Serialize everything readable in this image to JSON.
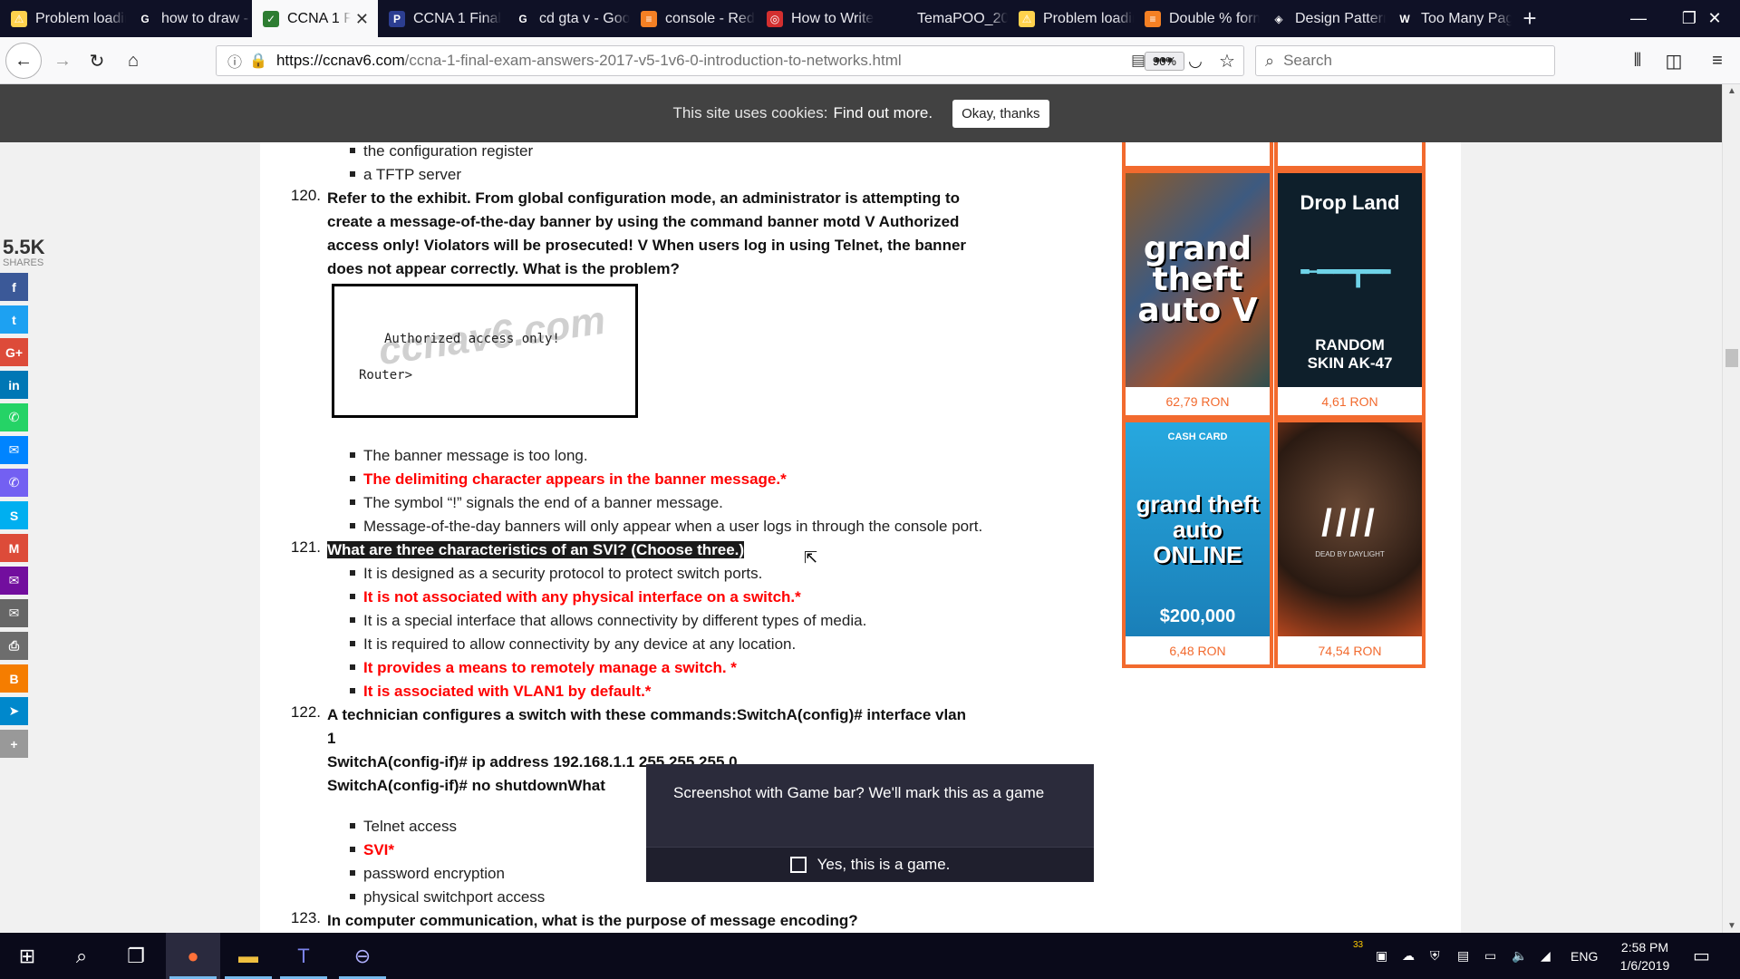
{
  "browser": {
    "tabs": [
      {
        "label": "Problem loading page",
        "icon_color": "#ffd24d",
        "glyph": "⚠"
      },
      {
        "label": "how to draw - Google",
        "icon_color": "#ffffff",
        "glyph": "G"
      },
      {
        "label": "CCNA 1 Final",
        "icon_color": "#2e7d32",
        "glyph": "✓",
        "active": true
      },
      {
        "label": "CCNA 1 Final",
        "icon_color": "#2c3e91",
        "glyph": "P"
      },
      {
        "label": "cd gta v - Google",
        "icon_color": "#ffffff",
        "glyph": "G"
      },
      {
        "label": "console - Red",
        "icon_color": "#f48024",
        "glyph": "≡"
      },
      {
        "label": "How to Write",
        "icon_color": "#d32f2f",
        "glyph": "◎"
      },
      {
        "label": "TemaPOO_2018.pdf",
        "icon_color": "",
        "glyph": ""
      },
      {
        "label": "Problem loading",
        "icon_color": "#ffd24d",
        "glyph": "⚠"
      },
      {
        "label": "Double % format",
        "icon_color": "#f48024",
        "glyph": "≡"
      },
      {
        "label": "Design Patterns",
        "icon_color": "#ffffff",
        "glyph": "◈"
      },
      {
        "label": "Too Many Pages",
        "icon_color": "#ffffff",
        "glyph": "W"
      }
    ],
    "url_host": "https://ccnav6.com",
    "url_path": "/ccna-1-final-exam-answers-2017-v5-1v6-0-introduction-to-networks.html",
    "zoom": "90%",
    "search_placeholder": "Search"
  },
  "cookie": {
    "text": "This site uses cookies:",
    "link": "Find out more.",
    "button": "Okay, thanks"
  },
  "shares": {
    "count": "5.5K",
    "label": "SHARES",
    "buttons": [
      {
        "name": "facebook",
        "color": "#3b5998",
        "glyph": "f"
      },
      {
        "name": "twitter",
        "color": "#1da1f2",
        "glyph": "t"
      },
      {
        "name": "googleplus",
        "color": "#dd4b39",
        "glyph": "G+"
      },
      {
        "name": "linkedin",
        "color": "#0077b5",
        "glyph": "in"
      },
      {
        "name": "whatsapp",
        "color": "#25d366",
        "glyph": "✆"
      },
      {
        "name": "messenger",
        "color": "#0084ff",
        "glyph": "✉"
      },
      {
        "name": "viber",
        "color": "#7360f2",
        "glyph": "✆"
      },
      {
        "name": "skype",
        "color": "#00aff0",
        "glyph": "S"
      },
      {
        "name": "gmail",
        "color": "#dd4b39",
        "glyph": "M"
      },
      {
        "name": "yahoo-mail",
        "color": "#720e9e",
        "glyph": "✉"
      },
      {
        "name": "email",
        "color": "#666666",
        "glyph": "✉"
      },
      {
        "name": "print",
        "color": "#6d6d6d",
        "glyph": "⎙"
      },
      {
        "name": "blogger",
        "color": "#f57d00",
        "glyph": "B"
      },
      {
        "name": "telegram",
        "color": "#0088cc",
        "glyph": "➤"
      },
      {
        "name": "more",
        "color": "#999999",
        "glyph": "+"
      }
    ]
  },
  "content": {
    "prev_answers": [
      "the configuration register",
      "a TFTP server"
    ],
    "q120": {
      "num": "120.",
      "lines": [
        "Refer to the exhibit. From global configuration mode, an administrator is attempting to",
        "create a message-of-the-day banner by using the command banner motd V Authorized",
        "access only! Violators will be prosecuted! V When users log in using Telnet, the banner",
        "does not appear correctly. What is the problem?"
      ],
      "exhibit_line1": "Authorized access only!",
      "exhibit_line2": "Router>",
      "exhibit_watermark": "ccnav6.com",
      "answers": [
        {
          "text": "The banner message is too long.",
          "correct": false
        },
        {
          "text": "The delimiting character appears in the banner message.*",
          "correct": true
        },
        {
          "text": "The symbol “!” signals the end of a banner message.",
          "correct": false
        },
        {
          "text": "Message-of-the-day banners will only appear when a user logs in through the console port.",
          "correct": false
        }
      ]
    },
    "q121": {
      "num": "121.",
      "text": "What are three characteristics of an SVI? (Choose three.)",
      "answers": [
        {
          "text": "It is designed as a security protocol to protect switch ports.",
          "correct": false
        },
        {
          "text": "It is not associated with any physical interface on a switch.*",
          "correct": true
        },
        {
          "text": "It is a special interface that allows connectivity by different types of media.",
          "correct": false
        },
        {
          "text": "It is required to allow connectivity by any device at any location.",
          "correct": false
        },
        {
          "text": "It provides a means to remotely manage a switch. *",
          "correct": true
        },
        {
          "text": "It is associated with VLAN1 by default.*",
          "correct": true
        }
      ]
    },
    "q122": {
      "num": "122.",
      "lines": [
        "A technician configures a switch with these commands:SwitchA(config)# interface vlan",
        "1",
        "SwitchA(config-if)# ip address 192.168.1.1 255.255.255.0",
        "SwitchA(config-if)# no shutdownWhat"
      ],
      "answers": [
        {
          "text": "Telnet access",
          "correct": false
        },
        {
          "text": "SVI*",
          "correct": true
        },
        {
          "text": "password encryption",
          "correct": false
        },
        {
          "text": "physical switchport access",
          "correct": false
        }
      ]
    },
    "q123": {
      "num": "123.",
      "text": "In computer communication, what is the purpose of message encoding?"
    }
  },
  "ads": [
    {
      "title": "grand theft auto V",
      "price": "62,79 RON",
      "bg": "#7a4a2a"
    },
    {
      "title": "Drop Land",
      "sub": "RANDOM SKIN AK-47",
      "price": "4,61 RON",
      "bg": "#0e1f2b"
    },
    {
      "title": "grand theft auto ONLINE",
      "top": "CASH CARD",
      "bottom": "$200,000",
      "price": "6,48 RON",
      "bg": "#1f9ed6"
    },
    {
      "title": "DEAD BY DAYLIGHT",
      "price": "74,54 RON",
      "bg": "#3a2418"
    }
  ],
  "gamebar": {
    "message": "Screenshot with Game bar? We'll mark this as a game",
    "checkbox_label": "Yes, this is a game."
  },
  "taskbar": {
    "time": "2:58 PM",
    "date": "1/6/2019",
    "lang": "ENG",
    "badge": "33"
  }
}
